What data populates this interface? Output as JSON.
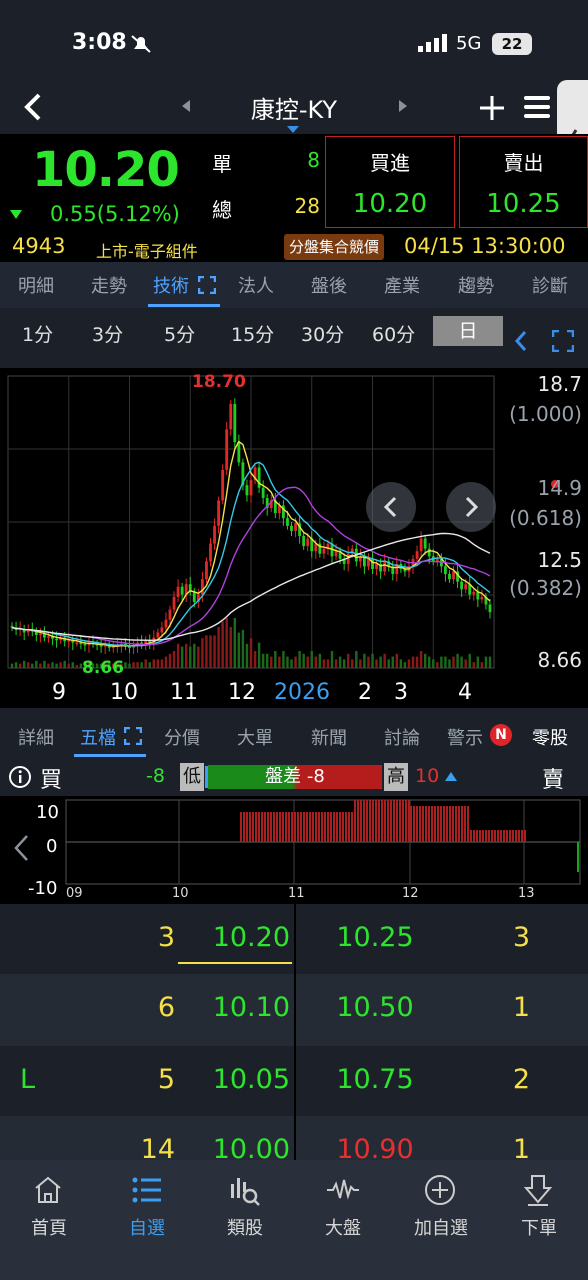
{
  "status": {
    "time": "3:08",
    "network": "5G",
    "battery": "22"
  },
  "header": {
    "title": "康控-KY"
  },
  "quote": {
    "price": "10.20",
    "change": "0.55(5.12%)",
    "single_label": "單",
    "single_value": "8",
    "total_label": "總",
    "total_value": "28",
    "buy_label": "買進",
    "buy_value": "10.20",
    "sell_label": "賣出",
    "sell_value": "10.25",
    "code": "4943",
    "market": "上市-電子組件",
    "session_badge": "分盤集合競價",
    "datetime": "04/15 13:30:00"
  },
  "tabs_top": [
    "明細",
    "走勢",
    "技術",
    "法人",
    "盤後",
    "產業",
    "趨勢",
    "診斷"
  ],
  "periods": [
    "1分",
    "3分",
    "5分",
    "15分",
    "30分",
    "60分",
    "日"
  ],
  "chart_data": {
    "type": "candlestick",
    "high_label": "18.70",
    "low_label": "8.66",
    "y_labels": [
      "18.7",
      "(1.000)",
      "14.9",
      "(0.618)",
      "12.5",
      "(0.382)",
      "8.66"
    ],
    "x_labels": [
      "9",
      "10",
      "11",
      "12",
      "2026",
      "2",
      "3",
      "4"
    ],
    "ylim": [
      8.0,
      19.5
    ],
    "closes": [
      9.6,
      9.5,
      9.55,
      9.4,
      9.5,
      9.45,
      9.3,
      9.35,
      9.2,
      9.25,
      9.15,
      9.1,
      9.2,
      9.05,
      9.1,
      9.0,
      9.0,
      8.95,
      8.9,
      9.0,
      8.95,
      8.9,
      8.85,
      8.9,
      8.8,
      8.85,
      8.9,
      8.95,
      8.85,
      8.8,
      8.9,
      9.0,
      8.9,
      9.1,
      9.0,
      9.2,
      9.4,
      9.6,
      9.9,
      10.3,
      10.8,
      11.2,
      10.9,
      11.3,
      11.0,
      10.6,
      10.9,
      11.5,
      12.2,
      12.9,
      13.6,
      14.6,
      15.8,
      17.4,
      18.4,
      16.9,
      16.1,
      15.2,
      14.8,
      15.4,
      15.9,
      15.1,
      14.7,
      14.3,
      14.6,
      14.1,
      14.4,
      13.9,
      13.6,
      13.4,
      13.7,
      13.2,
      12.8,
      13.1,
      12.6,
      12.9,
      12.5,
      12.7,
      12.9,
      12.4,
      12.6,
      12.3,
      12.1,
      12.5,
      12.7,
      12.2,
      12.4,
      12.0,
      12.3,
      11.9,
      12.1,
      11.8,
      12.2,
      12.0,
      11.7,
      12.1,
      11.9,
      11.8,
      12.0,
      12.3,
      12.6,
      13.1,
      12.7,
      12.4,
      12.2,
      12.3,
      12.0,
      11.7,
      11.5,
      11.8,
      11.4,
      11.1,
      11.3,
      10.9,
      11.0,
      10.7,
      10.8,
      10.5,
      10.2
    ],
    "grid": true
  },
  "tabs_bottom": [
    "詳細",
    "五檔",
    "分價",
    "大單",
    "新聞",
    "討論",
    "警示",
    "零股"
  ],
  "alert_badge": "N",
  "depth": {
    "buy_label": "買",
    "sell_label": "賣",
    "low_label": "低",
    "low_value": "-8",
    "spread_label": "盤差 -8",
    "high_label": "高",
    "high_value": "10",
    "mini_y": [
      "10",
      "0",
      "-10"
    ],
    "mini_x": [
      "09",
      "10",
      "11",
      "12",
      "13"
    ],
    "rows": [
      {
        "flag": "",
        "bid_qty": "3",
        "bid": "10.20",
        "ask": "10.25",
        "ask_qty": "3",
        "ask_color": "#2ee52e"
      },
      {
        "flag": "",
        "bid_qty": "6",
        "bid": "10.10",
        "ask": "10.50",
        "ask_qty": "1",
        "ask_color": "#2ee52e"
      },
      {
        "flag": "L",
        "bid_qty": "5",
        "bid": "10.05",
        "ask": "10.75",
        "ask_qty": "2",
        "ask_color": "#2ee52e"
      },
      {
        "flag": "",
        "bid_qty": "14",
        "bid": "10.00",
        "ask": "10.90",
        "ask_qty": "1",
        "ask_color": "#e53030"
      }
    ]
  },
  "nav": [
    {
      "label": "首頁",
      "icon": "home-icon"
    },
    {
      "label": "自選",
      "icon": "list-icon"
    },
    {
      "label": "類股",
      "icon": "chart-search-icon"
    },
    {
      "label": "大盤",
      "icon": "pulse-icon"
    },
    {
      "label": "加自選",
      "icon": "add-circle-icon"
    },
    {
      "label": "下單",
      "icon": "order-icon"
    }
  ]
}
